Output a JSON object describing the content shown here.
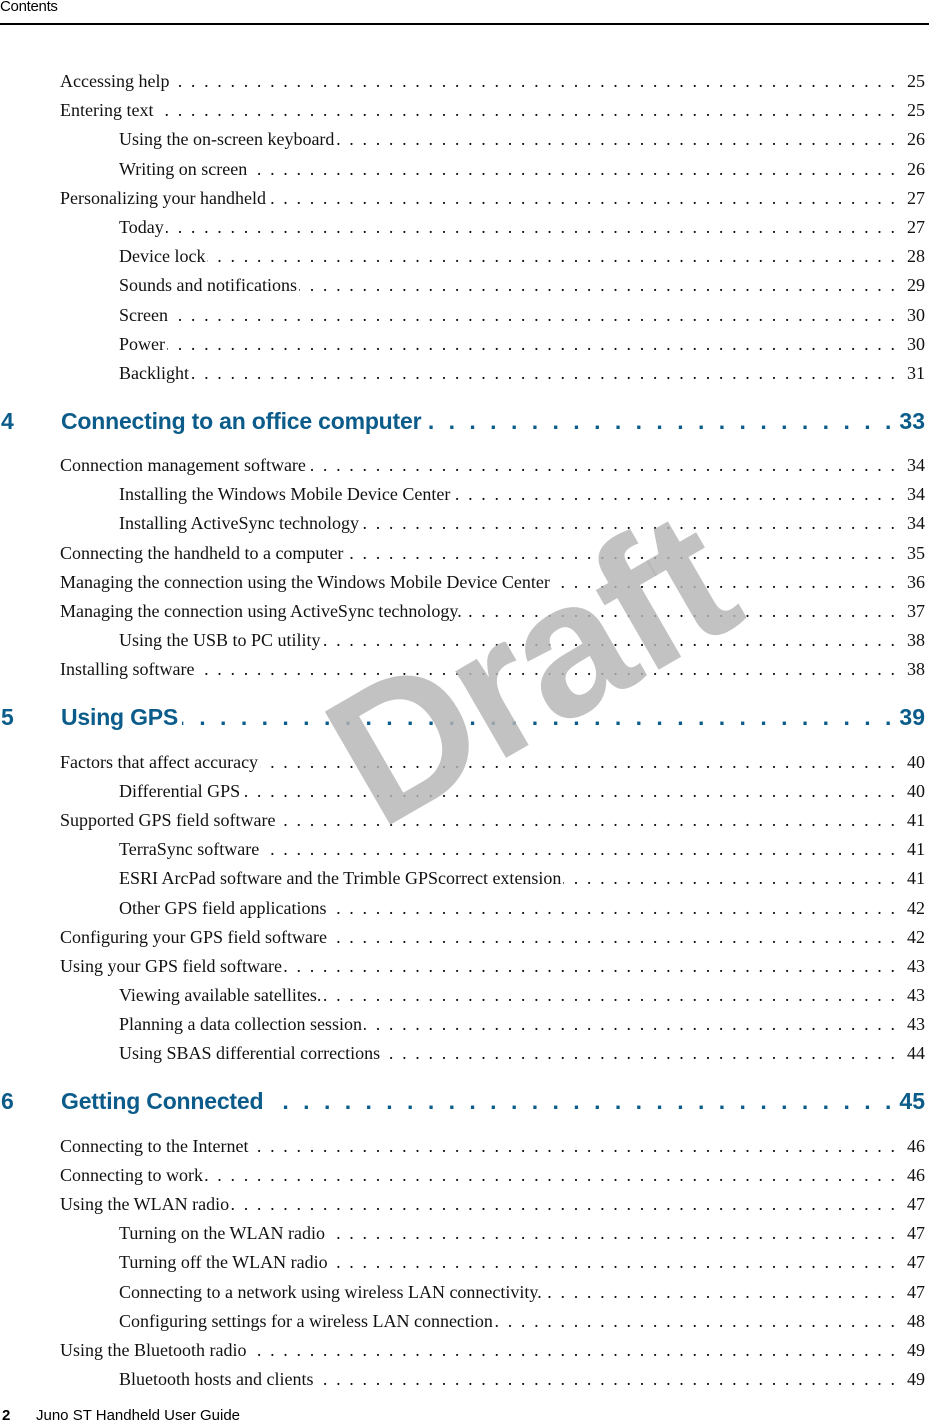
{
  "running_head": "Contents",
  "watermark": "Draft",
  "footer": {
    "page_number": "2",
    "title": "Juno ST Handheld User Guide"
  },
  "colors": {
    "chapter_heading": "#0b5c8a",
    "watermark": "#c4c4c4",
    "text": "#111111"
  },
  "toc": {
    "pre_entries": [
      {
        "level": 1,
        "title": "Accessing help",
        "page": "25"
      },
      {
        "level": 1,
        "title": "Entering text",
        "page": "25"
      },
      {
        "level": 2,
        "title": "Using the on-screen keyboard",
        "page": "26"
      },
      {
        "level": 2,
        "title": "Writing on screen",
        "page": "26"
      },
      {
        "level": 1,
        "title": "Personalizing your handheld",
        "page": "27"
      },
      {
        "level": 2,
        "title": "Today",
        "page": "27"
      },
      {
        "level": 2,
        "title": "Device lock",
        "page": "28"
      },
      {
        "level": 2,
        "title": "Sounds and notifications",
        "page": "29"
      },
      {
        "level": 2,
        "title": "Screen",
        "page": "30"
      },
      {
        "level": 2,
        "title": "Power",
        "page": "30"
      },
      {
        "level": 2,
        "title": "Backlight",
        "page": "31"
      }
    ],
    "chapters": [
      {
        "number": "4",
        "title": "Connecting to an office computer",
        "page": "33",
        "entries": [
          {
            "level": 1,
            "title": "Connection management software",
            "page": "34"
          },
          {
            "level": 2,
            "title": "Installing the Windows Mobile Device Center",
            "page": "34"
          },
          {
            "level": 2,
            "title": "Installing ActiveSync technology",
            "page": "34"
          },
          {
            "level": 1,
            "title": "Connecting the handheld to a computer",
            "page": "35"
          },
          {
            "level": 1,
            "title": "Managing the connection using the Windows Mobile Device Center",
            "page": "36"
          },
          {
            "level": 1,
            "title": "Managing the connection using ActiveSync technology.",
            "page": "37"
          },
          {
            "level": 2,
            "title": "Using the USB to PC utility",
            "page": "38"
          },
          {
            "level": 1,
            "title": "Installing software",
            "page": "38"
          }
        ]
      },
      {
        "number": "5",
        "title": "Using GPS",
        "page": "39",
        "entries": [
          {
            "level": 1,
            "title": "Factors that affect accuracy",
            "page": "40"
          },
          {
            "level": 2,
            "title": "Differential GPS",
            "page": "40"
          },
          {
            "level": 1,
            "title": "Supported GPS field software",
            "page": "41"
          },
          {
            "level": 2,
            "title": "TerraSync software",
            "page": "41"
          },
          {
            "level": 2,
            "title": "ESRI ArcPad software and the Trimble GPScorrect extension",
            "page": "41"
          },
          {
            "level": 2,
            "title": "Other GPS field applications",
            "page": "42"
          },
          {
            "level": 1,
            "title": "Configuring your GPS field software",
            "page": "42"
          },
          {
            "level": 1,
            "title": "Using your GPS field software",
            "page": "43"
          },
          {
            "level": 2,
            "title": "Viewing available satellites.",
            "page": "43"
          },
          {
            "level": 2,
            "title": "Planning a data collection session",
            "page": "43"
          },
          {
            "level": 2,
            "title": "Using SBAS differential corrections",
            "page": "44"
          }
        ]
      },
      {
        "number": "6",
        "title": "Getting Connected",
        "page": "45",
        "entries": [
          {
            "level": 1,
            "title": "Connecting to the Internet",
            "page": "46"
          },
          {
            "level": 1,
            "title": "Connecting to work",
            "page": "46"
          },
          {
            "level": 1,
            "title": "Using the WLAN radio",
            "page": "47"
          },
          {
            "level": 2,
            "title": "Turning on the WLAN radio",
            "page": "47"
          },
          {
            "level": 2,
            "title": "Turning off the WLAN radio",
            "page": "47"
          },
          {
            "level": 2,
            "title": "Connecting to a network using wireless LAN connectivity.",
            "page": "47"
          },
          {
            "level": 2,
            "title": "Configuring settings for a wireless LAN connection",
            "page": "48"
          },
          {
            "level": 1,
            "title": "Using the Bluetooth radio",
            "page": "49"
          },
          {
            "level": 2,
            "title": "Bluetooth hosts and clients",
            "page": "49"
          }
        ]
      }
    ]
  }
}
